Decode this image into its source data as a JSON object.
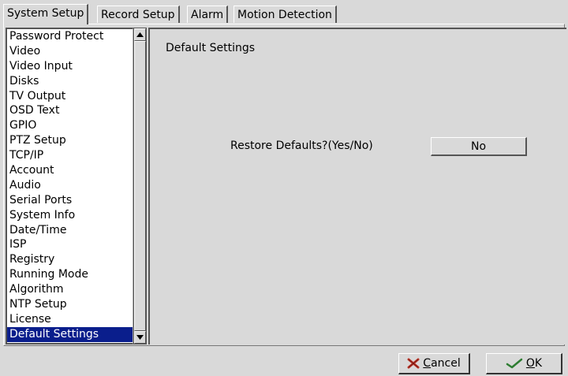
{
  "tabs": [
    {
      "label": "System Setup",
      "active": true
    },
    {
      "label": "Record Setup",
      "active": false
    },
    {
      "label": "Alarm",
      "active": false
    },
    {
      "label": "Motion Detection",
      "active": false
    }
  ],
  "sidebar": {
    "items": [
      "Password Protect",
      "Video",
      "Video Input",
      "Disks",
      "TV Output",
      "OSD Text",
      "GPIO",
      "PTZ Setup",
      "TCP/IP",
      "Account",
      "Audio",
      "Serial Ports",
      "System Info",
      "Date/Time",
      "ISP",
      "Registry",
      "Running Mode",
      "Algorithm",
      "NTP Setup",
      "License",
      "Default Settings"
    ],
    "selected_index": 20
  },
  "main": {
    "section_title": "Default Settings",
    "restore_label": "Restore Defaults?(Yes/No)",
    "restore_value": "No"
  },
  "buttons": {
    "cancel_first": "C",
    "cancel_rest": "ancel",
    "ok_first": "O",
    "ok_rest": "K"
  },
  "icons": {
    "cancel": "x-cross-icon",
    "ok": "checkmark-icon"
  },
  "colors": {
    "background": "#d9d9d9",
    "selection": "#0a1e8c",
    "cancel_icon": "#c0392b",
    "ok_icon": "#2e7d32"
  }
}
